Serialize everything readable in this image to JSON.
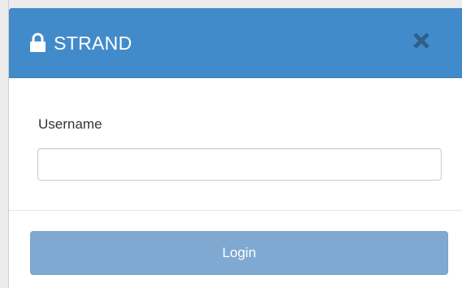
{
  "dialog": {
    "title": "STRAND",
    "title_icon": "lock-icon",
    "close_icon": "close-icon"
  },
  "form": {
    "username_label": "Username",
    "username_value": "",
    "username_placeholder": ""
  },
  "footer": {
    "login_label": "Login"
  },
  "colors": {
    "header_bg": "#428bca",
    "button_bg": "#7fa9d1",
    "close_icon": "#2f5f8a"
  }
}
